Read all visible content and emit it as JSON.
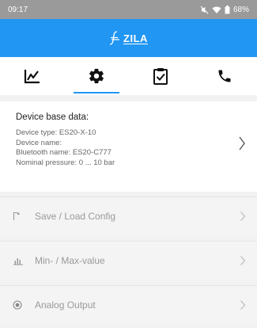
{
  "status_bar": {
    "time": "09:17",
    "battery": "68%"
  },
  "header": {
    "logo_text": "ZILA"
  },
  "tabs": [
    {
      "id": "chart",
      "icon": "chart-icon",
      "active": false
    },
    {
      "id": "settings",
      "icon": "gear-icon",
      "active": true
    },
    {
      "id": "checklist",
      "icon": "clipboard-check-icon",
      "active": false
    },
    {
      "id": "contact",
      "icon": "phone-icon",
      "active": false
    }
  ],
  "device": {
    "title": "Device base data:",
    "type": "Device type: ES20-X-10",
    "name": "Device name:",
    "bluetooth": "Bluetooth name: ES20-C777",
    "pressure": "Nominal pressure: 0 ... 10 bar"
  },
  "menu": [
    {
      "label": "Save / Load Config",
      "icon": "save-config-icon"
    },
    {
      "label": "Min- / Max-value",
      "icon": "bar-chart-icon"
    },
    {
      "label": "Analog Output",
      "icon": "radio-target-icon"
    }
  ],
  "colors": {
    "accent": "#2196f3",
    "status_bar": "#9a9a9a",
    "disabled_text": "#999999"
  }
}
